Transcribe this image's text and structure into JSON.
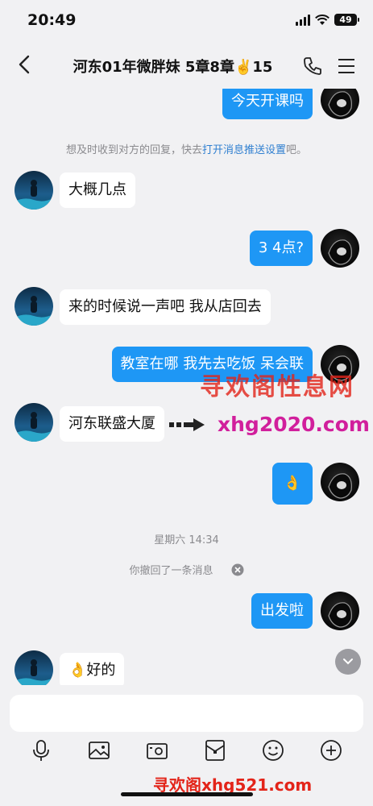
{
  "status_bar": {
    "time": "20:49",
    "battery": "49"
  },
  "nav": {
    "title": "河东01年微胖妹 5章8章✌️15"
  },
  "messages": [
    {
      "dir": "out",
      "text": "今天开课吗"
    },
    {
      "dir": "in",
      "text": "大概几点"
    },
    {
      "dir": "out",
      "text": "3 4点?"
    },
    {
      "dir": "in",
      "text": "来的时候说一声吧 我从店回去"
    },
    {
      "dir": "out",
      "text": "教室在哪 我先去吃饭 呆会联"
    },
    {
      "dir": "in",
      "text": "河东联盛大厦"
    },
    {
      "dir": "out",
      "text": "👌"
    },
    {
      "dir": "out",
      "text": "出发啦"
    },
    {
      "dir": "in",
      "text": "👌好的"
    }
  ],
  "system": {
    "notice_prefix": "想及时收到对方的回复，快去",
    "notice_link": "打开消息推送设置",
    "notice_suffix": "吧。",
    "time_separator": "星期六 14:34",
    "recall_note": "你撤回了一条消息"
  },
  "watermarks": {
    "top_cn": "寻欢阁性息网",
    "top_url": "xhg2020.com",
    "bottom": "寻欢阁xhg521.com"
  },
  "composer": {
    "placeholder": ""
  },
  "toolbar": [
    {
      "icon": "microphone-icon"
    },
    {
      "icon": "image-icon"
    },
    {
      "icon": "camera-icon"
    },
    {
      "icon": "red-packet-icon"
    },
    {
      "icon": "emoji-icon"
    },
    {
      "icon": "plus-icon"
    }
  ],
  "colors": {
    "bubble_out": "#1e97f5",
    "bubble_in": "#ffffff",
    "background": "#f1f1f3",
    "link": "#2f7fd0"
  }
}
